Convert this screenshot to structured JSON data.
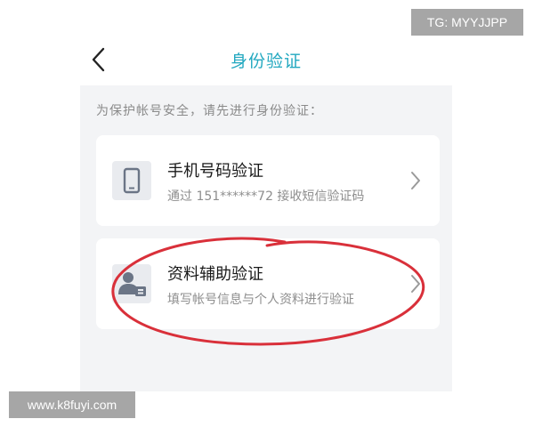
{
  "watermarks": {
    "top": "TG: MYYJJPP",
    "bottom": "www.k8fuyi.com"
  },
  "header": {
    "title": "身份验证"
  },
  "hint": "为保护帐号安全，请先进行身份验证：",
  "options": [
    {
      "title": "手机号码验证",
      "subtitle": "通过 151******72 接收短信验证码",
      "icon": "phone-icon"
    },
    {
      "title": "资料辅助验证",
      "subtitle": "填写帐号信息与个人资料进行验证",
      "icon": "profile-icon"
    }
  ],
  "colors": {
    "title": "#22a8c0",
    "annotation": "#d9303a",
    "background": "#f3f4f6"
  }
}
